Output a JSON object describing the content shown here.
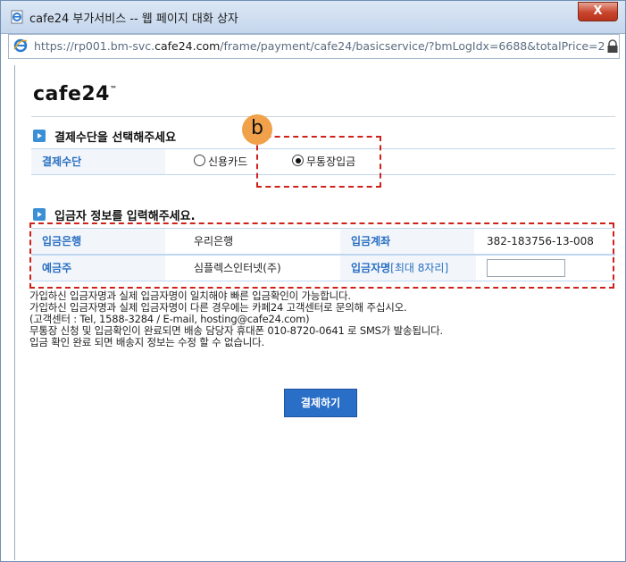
{
  "window": {
    "title": "cafe24 부가서비스 -- 웹 페이지 대화 상자",
    "close_label": "X",
    "url_prefix": "https://rp001.bm-svc.",
    "url_domain": "cafe24.com",
    "url_suffix": "/frame/payment/cafe24/basicservice/?bmLogIdx=6688&totalPrice=2"
  },
  "logo": {
    "text": "cafe24",
    "mark": "™"
  },
  "payment_section": {
    "heading": "결제수단을 선택해주세요",
    "method_label": "결제수단",
    "options": [
      {
        "label": "신용카드",
        "selected": false
      },
      {
        "label": "무통장입금",
        "selected": true
      }
    ]
  },
  "annotation": {
    "badge": "b",
    "color": "#d0201a",
    "badge_color": "#f0a14a"
  },
  "depositor_section": {
    "heading": "입금자 정보를 입력해주세요.",
    "bank_label": "입금은행",
    "bank_value": "우리은행",
    "account_label": "입금계좌",
    "account_value": "382-183756-13-008",
    "holder_label": "예금주",
    "holder_value": "심플렉스인터넷(주)",
    "depositor_label": "입금자명",
    "depositor_hint": "[최대 8자리]",
    "depositor_value": ""
  },
  "notice_lines": [
    "가입하신 입금자명과 실제 입금자명이 일치해야 빠른 입금확인이 가능합니다.",
    "가입하신 입금자명과 실제 입금자명이 다른 경우에는 카페24 고객센터로 문의해 주십시오.",
    "(고객센터 : Tel, 1588-3284 / E-mail, hosting@cafe24.com)",
    "무통장 신청 및 입금확인이 완료되면 배송 담당자 휴대폰 010-8720-0641 로 SMS가 발송됩니다.",
    "입금 확인 완료 되면 배송지 정보는 수정 할 수 없습니다."
  ],
  "pay_button": "결제하기"
}
